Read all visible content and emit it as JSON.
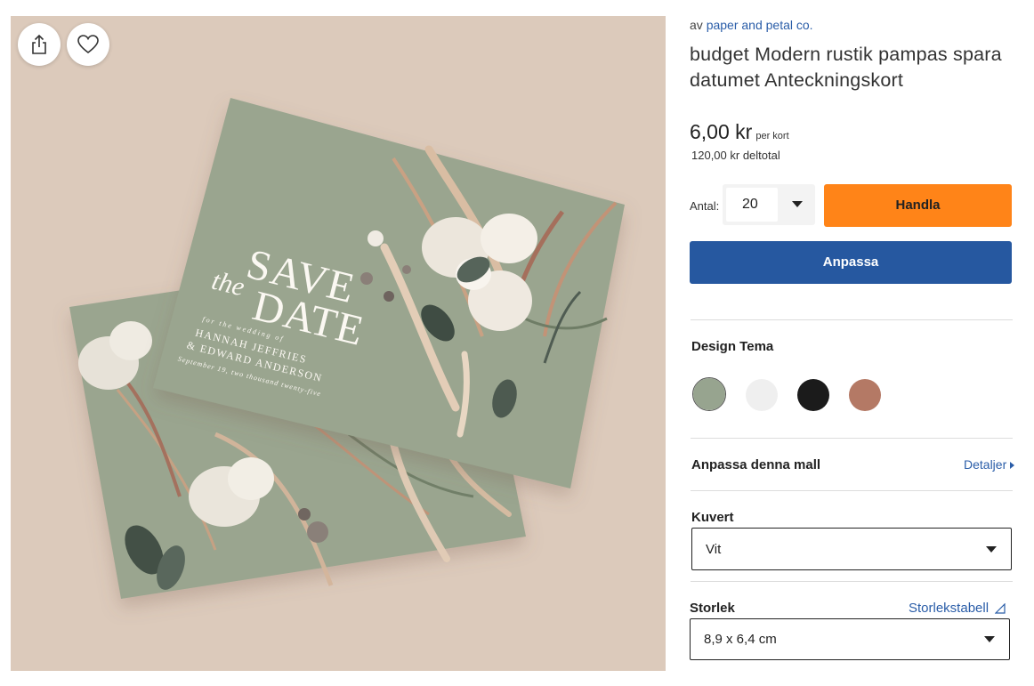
{
  "image": {
    "card_text": {
      "save": "SAVE",
      "the": "the",
      "date": "DATE",
      "for_wedding": "for the wedding of",
      "name1": "HANNAH JEFFRIES",
      "name2": "& EDWARD ANDERSON",
      "date_line": "September 19, two thousand twenty-five"
    },
    "share_icon": "share-icon",
    "favorite_icon": "heart-icon"
  },
  "product": {
    "brand_prefix": "av",
    "brand_name": "paper and petal co.",
    "title": "budget Modern rustik pampas spara datumet Anteckningskort",
    "price": "6,00 kr",
    "price_unit": "per kort",
    "subtotal": "120,00 kr deltotal",
    "quantity_label": "Antal:",
    "quantity_value": "20",
    "buy_label": "Handla",
    "customize_label": "Anpassa"
  },
  "design_theme": {
    "label": "Design Tema",
    "swatches": [
      {
        "name": "sage",
        "color": "#97a48f",
        "selected": true
      },
      {
        "name": "light-gray",
        "color": "#efefef",
        "selected": false
      },
      {
        "name": "black",
        "color": "#1b1b1b",
        "selected": false
      },
      {
        "name": "terracotta",
        "color": "#b47965",
        "selected": false
      }
    ]
  },
  "template": {
    "label": "Anpassa denna mall",
    "details_link": "Detaljer"
  },
  "envelope": {
    "label": "Kuvert",
    "value": "Vit"
  },
  "size": {
    "label": "Storlek",
    "chart_link": "Storlekstabell",
    "value": "8,9 x 6,4 cm"
  },
  "colors": {
    "accent_orange": "#ff8418",
    "primary_blue": "#2658a0",
    "link_blue": "#2a5da8",
    "image_background": "#dccabb",
    "card_green": "#9aa58f"
  }
}
